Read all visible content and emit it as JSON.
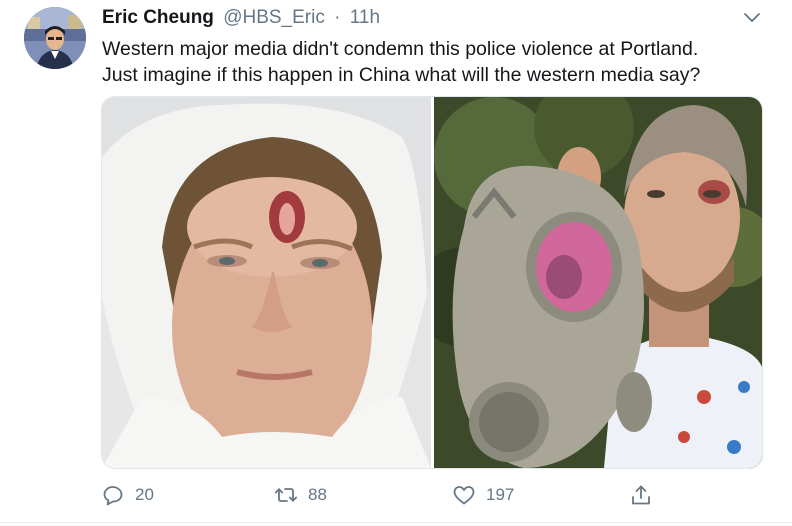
{
  "tweet": {
    "author_name": "Eric Cheung",
    "handle": "@HBS_Eric",
    "separator": "·",
    "time": "11h",
    "text_line1": "Western major media didn't condemn this police violence at Portland.",
    "text_line2": "Just imagine if this happen in China what will the western media say?"
  },
  "actions": {
    "replies": "20",
    "retweets": "88",
    "likes": "197"
  },
  "icons": {
    "caret": "chevron-down-icon",
    "reply": "reply-icon",
    "retweet": "retweet-icon",
    "like": "heart-icon",
    "share": "share-icon"
  },
  "colors": {
    "text": "#14171a",
    "secondary": "#657786",
    "border": "#e1e8ed"
  }
}
